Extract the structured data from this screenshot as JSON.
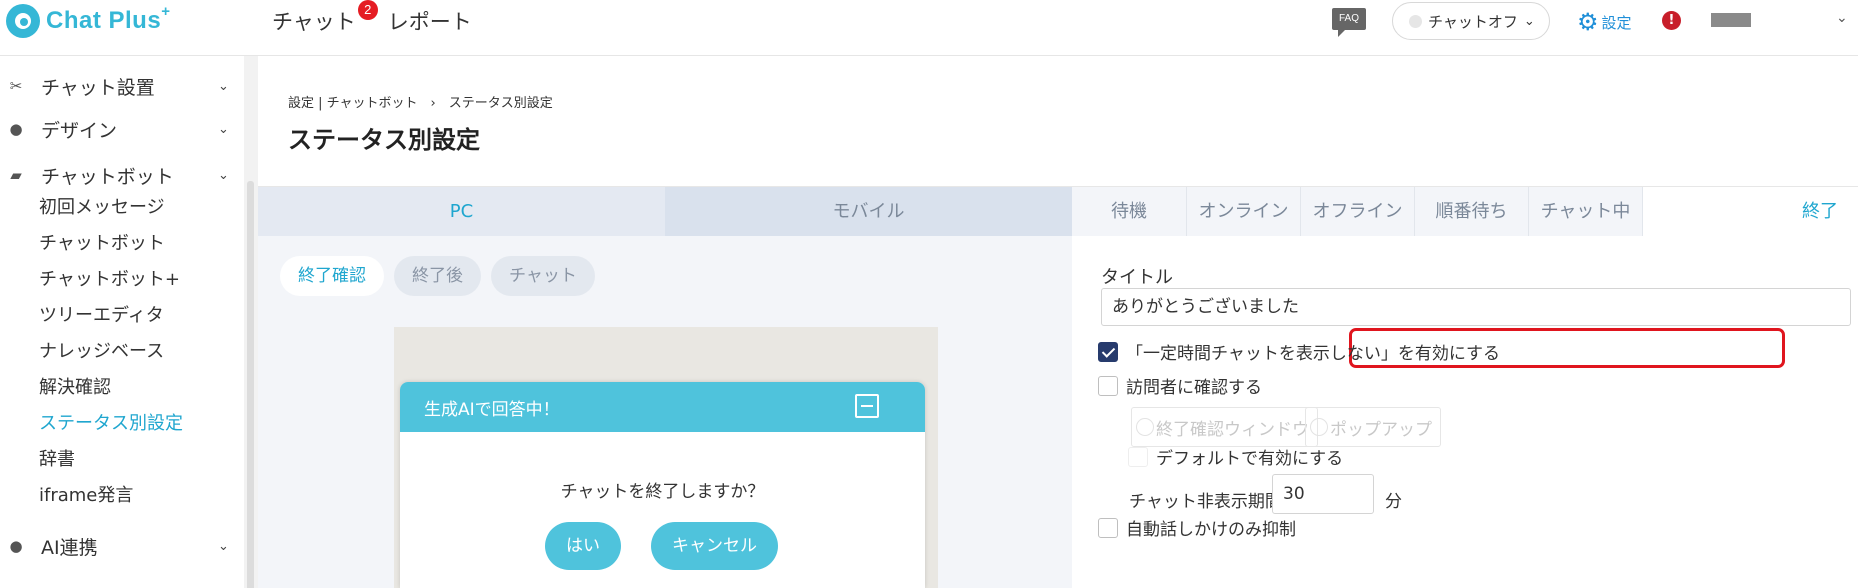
{
  "header": {
    "logo_text": "Chat Plus",
    "logo_sup": "+",
    "nav": [
      {
        "label": "チャット",
        "badge": "2"
      },
      {
        "label": "レポート"
      }
    ],
    "faq_label": "FAQ",
    "status_select": "チャットオフ",
    "settings_label": "設定",
    "alert_label": "!"
  },
  "sidebar": {
    "sections": [
      {
        "label": "チャット設置",
        "icon": "tools-icon"
      },
      {
        "label": "デザイン",
        "icon": "palette-icon"
      },
      {
        "label": "チャットボット",
        "icon": "chat-bubble-icon"
      },
      {
        "label": "AI連携",
        "icon": "bulb-icon"
      }
    ],
    "items": [
      "初回メッセージ",
      "チャットボット",
      "チャットボット+",
      "ツリーエディタ",
      "ナレッジベース",
      "解決確認",
      "ステータス別設定",
      "辞書",
      "iframe発言"
    ],
    "active_item": "ステータス別設定"
  },
  "page": {
    "breadcrumb": "設定 | チャットボット　›　ステータス別設定",
    "title": "ステータス別設定"
  },
  "preview": {
    "device_tabs": [
      "PC",
      "モバイル"
    ],
    "active_device": "PC",
    "pills": [
      "終了確認",
      "終了後",
      "チャット"
    ],
    "active_pill": "終了確認",
    "chat_header": "生成AIで回答中！",
    "question": "チャットを終了しますか？",
    "yes_button": "はい",
    "cancel_button": "キャンセル"
  },
  "settings": {
    "status_tabs": [
      "待機",
      "オンライン",
      "オフライン",
      "順番待ち",
      "チャット中",
      "終了"
    ],
    "active_status": "終了",
    "title_label": "タイトル",
    "title_value": "ありがとうございました",
    "hide_chat_checkbox": {
      "label": "「一定時間チャットを表示しない」を有効にする",
      "checked": true
    },
    "confirm_visitor_checkbox": {
      "label": "訪問者に確認する",
      "checked": false
    },
    "confirm_options": [
      "終了確認ウィンドウ",
      "ポップアップ"
    ],
    "default_enable_checkbox": {
      "label": "デフォルトで有効にする",
      "checked": false
    },
    "period_label": "チャット非表示期間",
    "period_value": "30",
    "period_unit": "分",
    "suppress_checkbox": {
      "label": "自動話しかけのみ抑制",
      "checked": false
    }
  },
  "colors": {
    "accent": "#1fa6cf",
    "chat_header": "#4fc3dc",
    "checkbox_checked": "#273b6d",
    "highlight": "#e0151e",
    "badge": "#e51c23"
  }
}
